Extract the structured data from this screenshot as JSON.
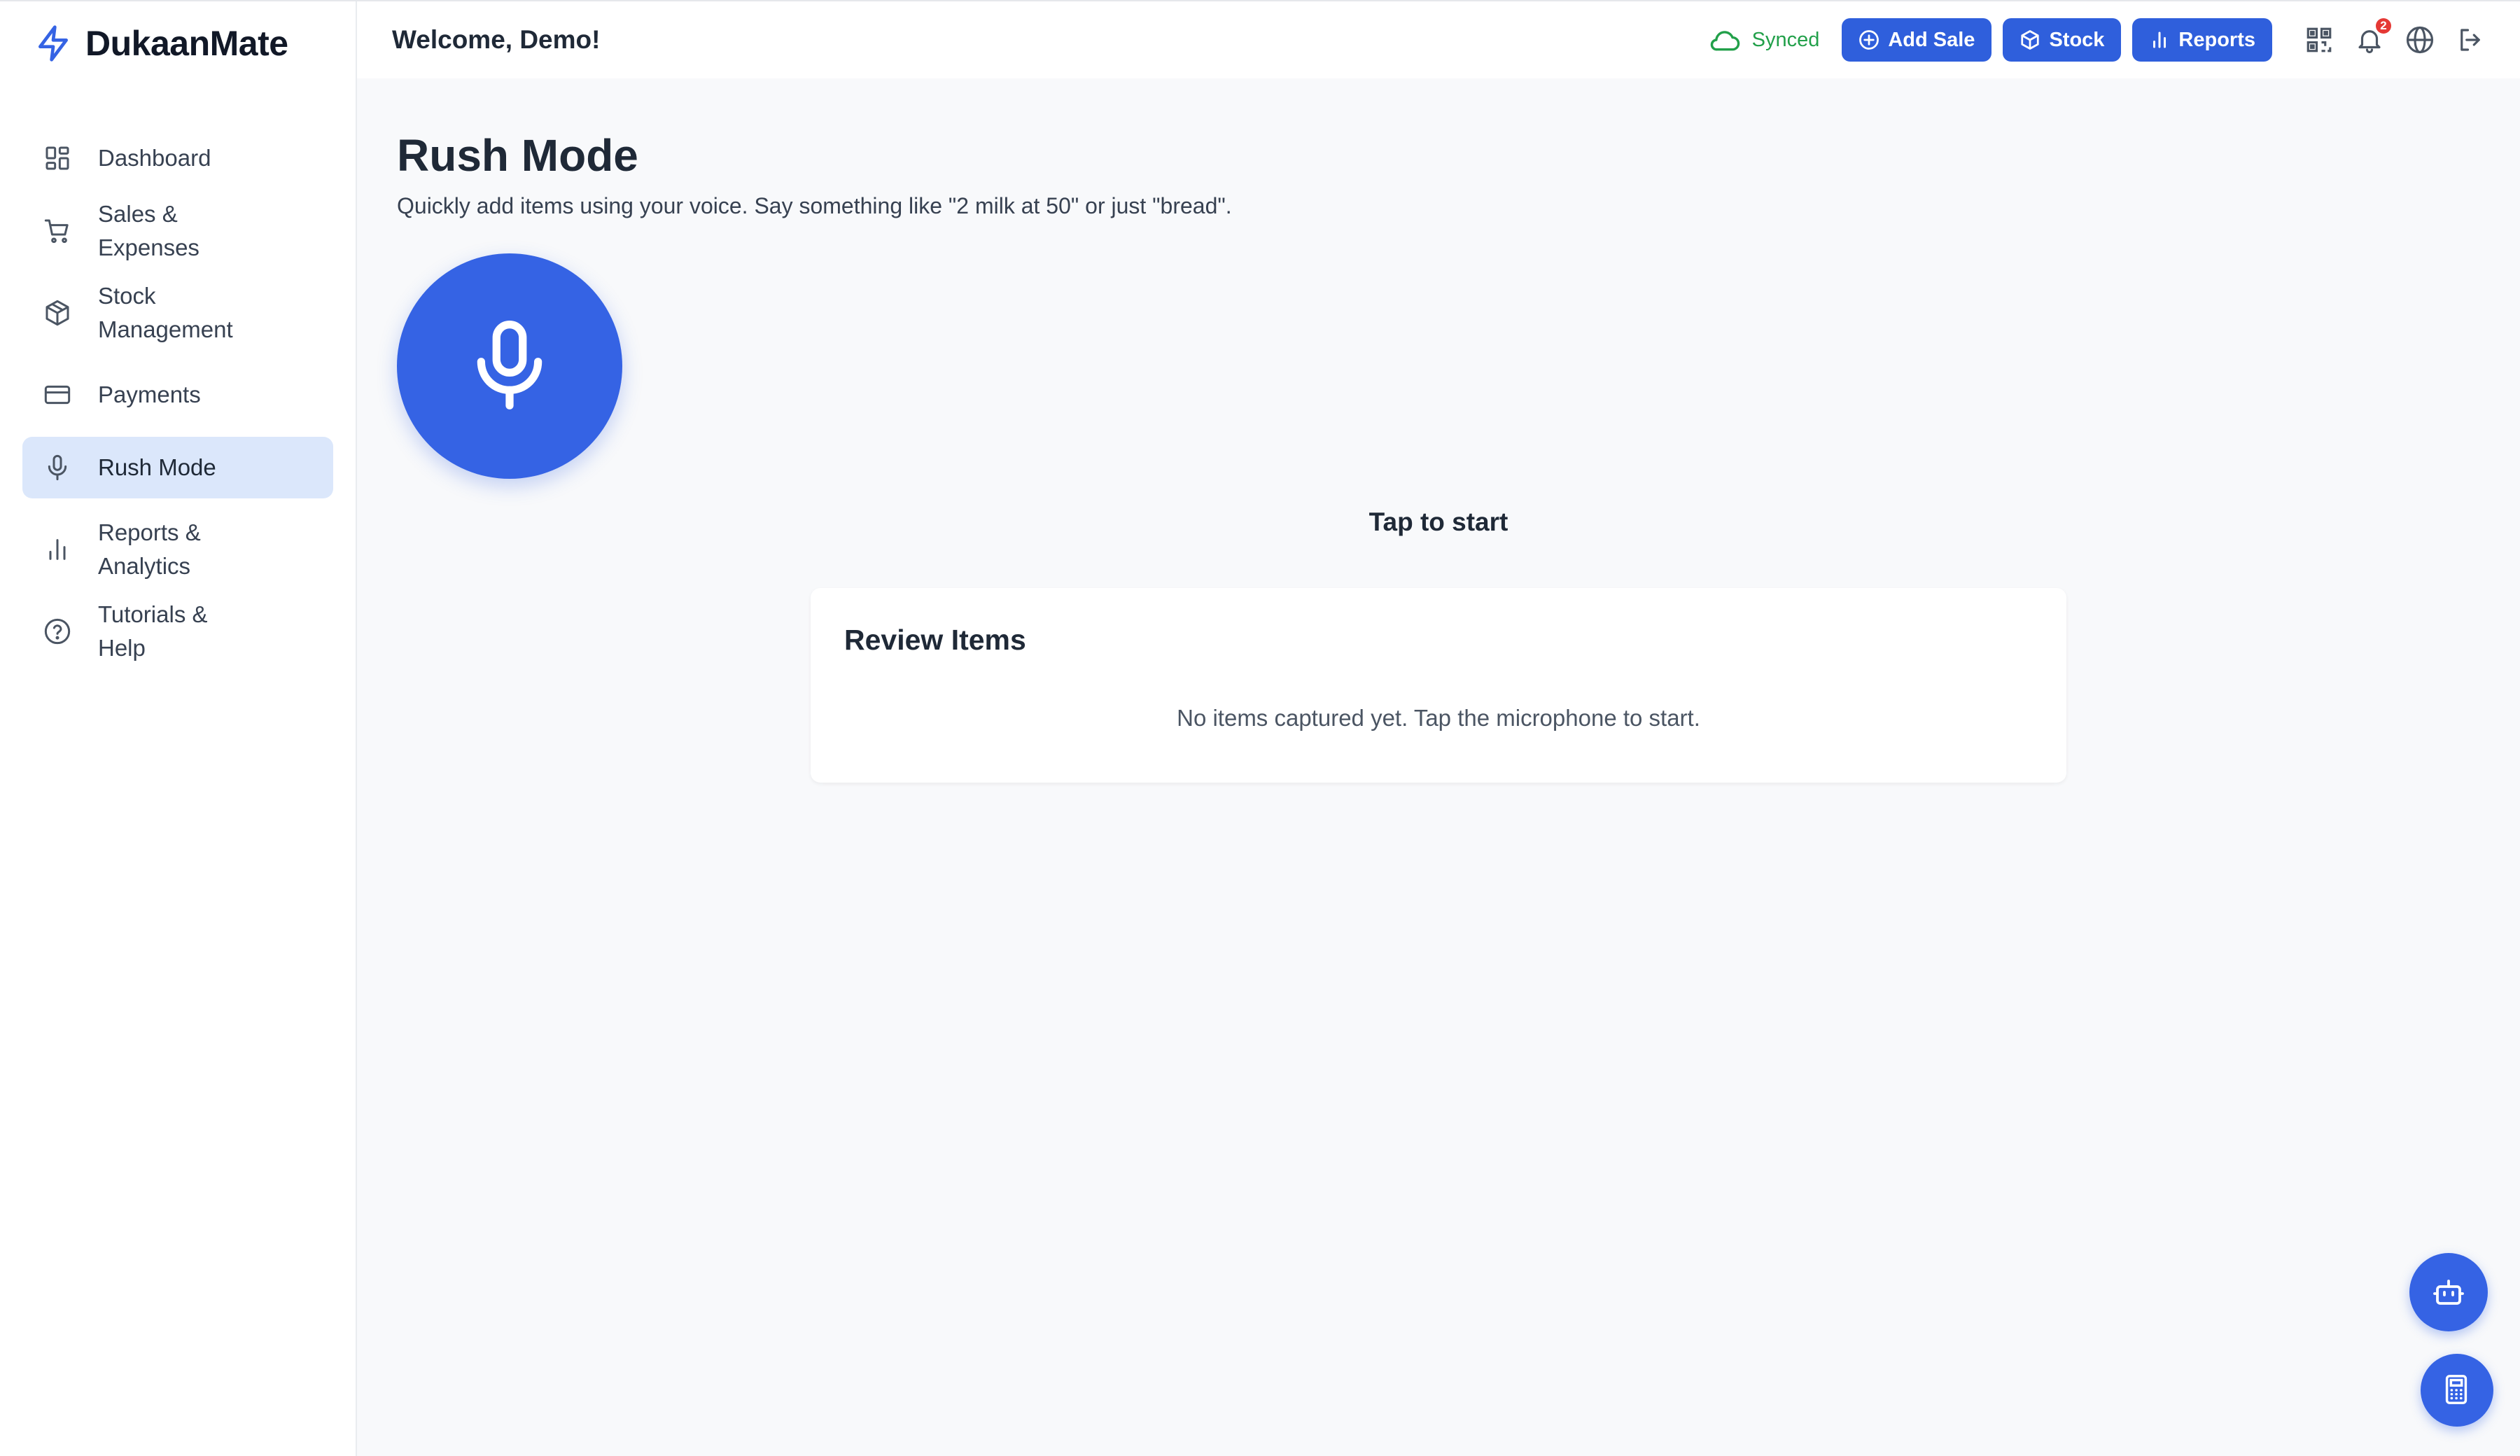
{
  "brand": {
    "name": "DukaanMate"
  },
  "sidebar": {
    "items": [
      {
        "label": "Dashboard",
        "icon": "dashboard-icon"
      },
      {
        "label": "Sales & Expenses",
        "icon": "cart-icon"
      },
      {
        "label": "Stock Management",
        "icon": "box-icon"
      },
      {
        "label": "Payments",
        "icon": "credit-card-icon"
      },
      {
        "label": "Rush Mode",
        "icon": "mic-icon",
        "active": true
      },
      {
        "label": "Reports & Analytics",
        "icon": "bar-chart-icon"
      },
      {
        "label": "Tutorials & Help",
        "icon": "help-circle-icon"
      }
    ]
  },
  "header": {
    "welcome": "Welcome, Demo!",
    "sync_status": "Synced",
    "buttons": {
      "add_sale": "Add Sale",
      "stock": "Stock",
      "reports": "Reports"
    },
    "notification_count": "2"
  },
  "page": {
    "title": "Rush Mode",
    "subtitle": "Quickly add items using your voice. Say something like \"2 milk at 50\" or just \"bread\".",
    "tap_label": "Tap to start"
  },
  "review": {
    "title": "Review Items",
    "empty_message": "No items captured yet. Tap the microphone to start."
  },
  "colors": {
    "accent": "#3563e4",
    "sync_green": "#22a04a",
    "active_nav_bg": "#dbe7fb",
    "badge_red": "#e53935"
  }
}
